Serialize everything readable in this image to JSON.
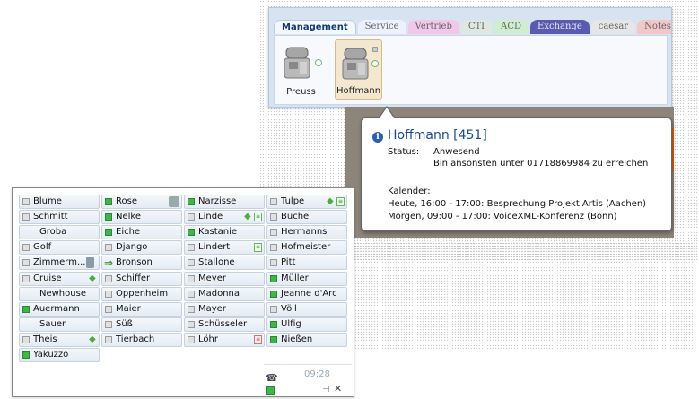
{
  "top_window": {
    "tabs": [
      {
        "label": "Management",
        "color": "#e8f1e0",
        "active": true
      },
      {
        "label": "Service",
        "color": "#eef0ff"
      },
      {
        "label": "Vertrieb",
        "color": "#f2c8ea"
      },
      {
        "label": "CTI",
        "color": "#dfe8e0"
      },
      {
        "label": "ACD",
        "color": "#cfeecf"
      },
      {
        "label": "Exchange",
        "color": "#5a5ab0"
      },
      {
        "label": "caesar",
        "color": "#e6e6e6"
      },
      {
        "label": "Notes/Gr",
        "color": "#f3c7c7"
      }
    ],
    "phones": [
      {
        "name": "Preuss",
        "selected": false,
        "led": "circle"
      },
      {
        "name": "Hoffmann",
        "selected": true,
        "led": "circle"
      }
    ]
  },
  "tooltip": {
    "title": "Hoffmann [451]",
    "status_label": "Status:",
    "status_value": "Anwesend",
    "status_note": "Bin ansonsten unter 01718869984 zu erreichen",
    "calendar_label": "Kalender:",
    "calendar_entries": [
      "Heute, 16:00 - 17:00: Besprechung Projekt Artis (Aachen)",
      "Morgen, 09:00 - 17:00: VoiceXML-Konferenz (Bonn)"
    ]
  },
  "contacts": {
    "columns": [
      [
        {
          "name": "Blume",
          "state": "gray"
        },
        {
          "name": "Schmitt",
          "state": "gray"
        },
        {
          "name": "Groba",
          "state": "none"
        },
        {
          "name": "Golf",
          "state": "gray"
        },
        {
          "name": "Zimmerm...",
          "state": "gray",
          "icon": "trash-icon"
        },
        {
          "name": "Cruise",
          "state": "gray",
          "icon": "tag-icon"
        },
        {
          "name": "Newhouse",
          "state": "none"
        },
        {
          "name": "Auermann",
          "state": "green"
        },
        {
          "name": "Sauer",
          "state": "none"
        },
        {
          "name": "Theis",
          "state": "gray",
          "icon": "tag-icon"
        },
        {
          "name": "Yakuzzo",
          "state": "green"
        }
      ],
      [
        {
          "name": "Rose",
          "state": "green",
          "icon": "people-icon"
        },
        {
          "name": "Nelke",
          "state": "green"
        },
        {
          "name": "Eiche",
          "state": "green"
        },
        {
          "name": "Django",
          "state": "gray"
        },
        {
          "name": "Bronson",
          "state": "arrow"
        },
        {
          "name": "Schiffer",
          "state": "gray"
        },
        {
          "name": "Oppenheim",
          "state": "gray"
        },
        {
          "name": "Maier",
          "state": "gray"
        },
        {
          "name": "Süß",
          "state": "gray"
        },
        {
          "name": "Tierbach",
          "state": "gray"
        }
      ],
      [
        {
          "name": "Narzisse",
          "state": "green"
        },
        {
          "name": "Linde",
          "state": "gray",
          "icon": "tag-doc"
        },
        {
          "name": "Kastanie",
          "state": "green"
        },
        {
          "name": "Lindert",
          "state": "gray",
          "icon": "doc-icon"
        },
        {
          "name": "Stallone",
          "state": "gray"
        },
        {
          "name": "Meyer",
          "state": "gray"
        },
        {
          "name": "Madonna",
          "state": "gray"
        },
        {
          "name": "Mayer",
          "state": "gray"
        },
        {
          "name": "Schüsseler",
          "state": "gray"
        },
        {
          "name": "Löhr",
          "state": "gray",
          "icon": "doc-red-icon"
        }
      ],
      [
        {
          "name": "Tulpe",
          "state": "gray",
          "icon": "tag-doc"
        },
        {
          "name": "Buche",
          "state": "gray"
        },
        {
          "name": "Hermanns",
          "state": "gray"
        },
        {
          "name": "Hofmeister",
          "state": "gray"
        },
        {
          "name": "Pitt",
          "state": "gray"
        },
        {
          "name": "Müller",
          "state": "green"
        },
        {
          "name": "Jeanne d'Arc",
          "state": "green"
        },
        {
          "name": "Völl",
          "state": "gray"
        },
        {
          "name": "Ulfig",
          "state": "green"
        },
        {
          "name": "Nießen",
          "state": "green"
        }
      ]
    ],
    "time": "09:28"
  }
}
